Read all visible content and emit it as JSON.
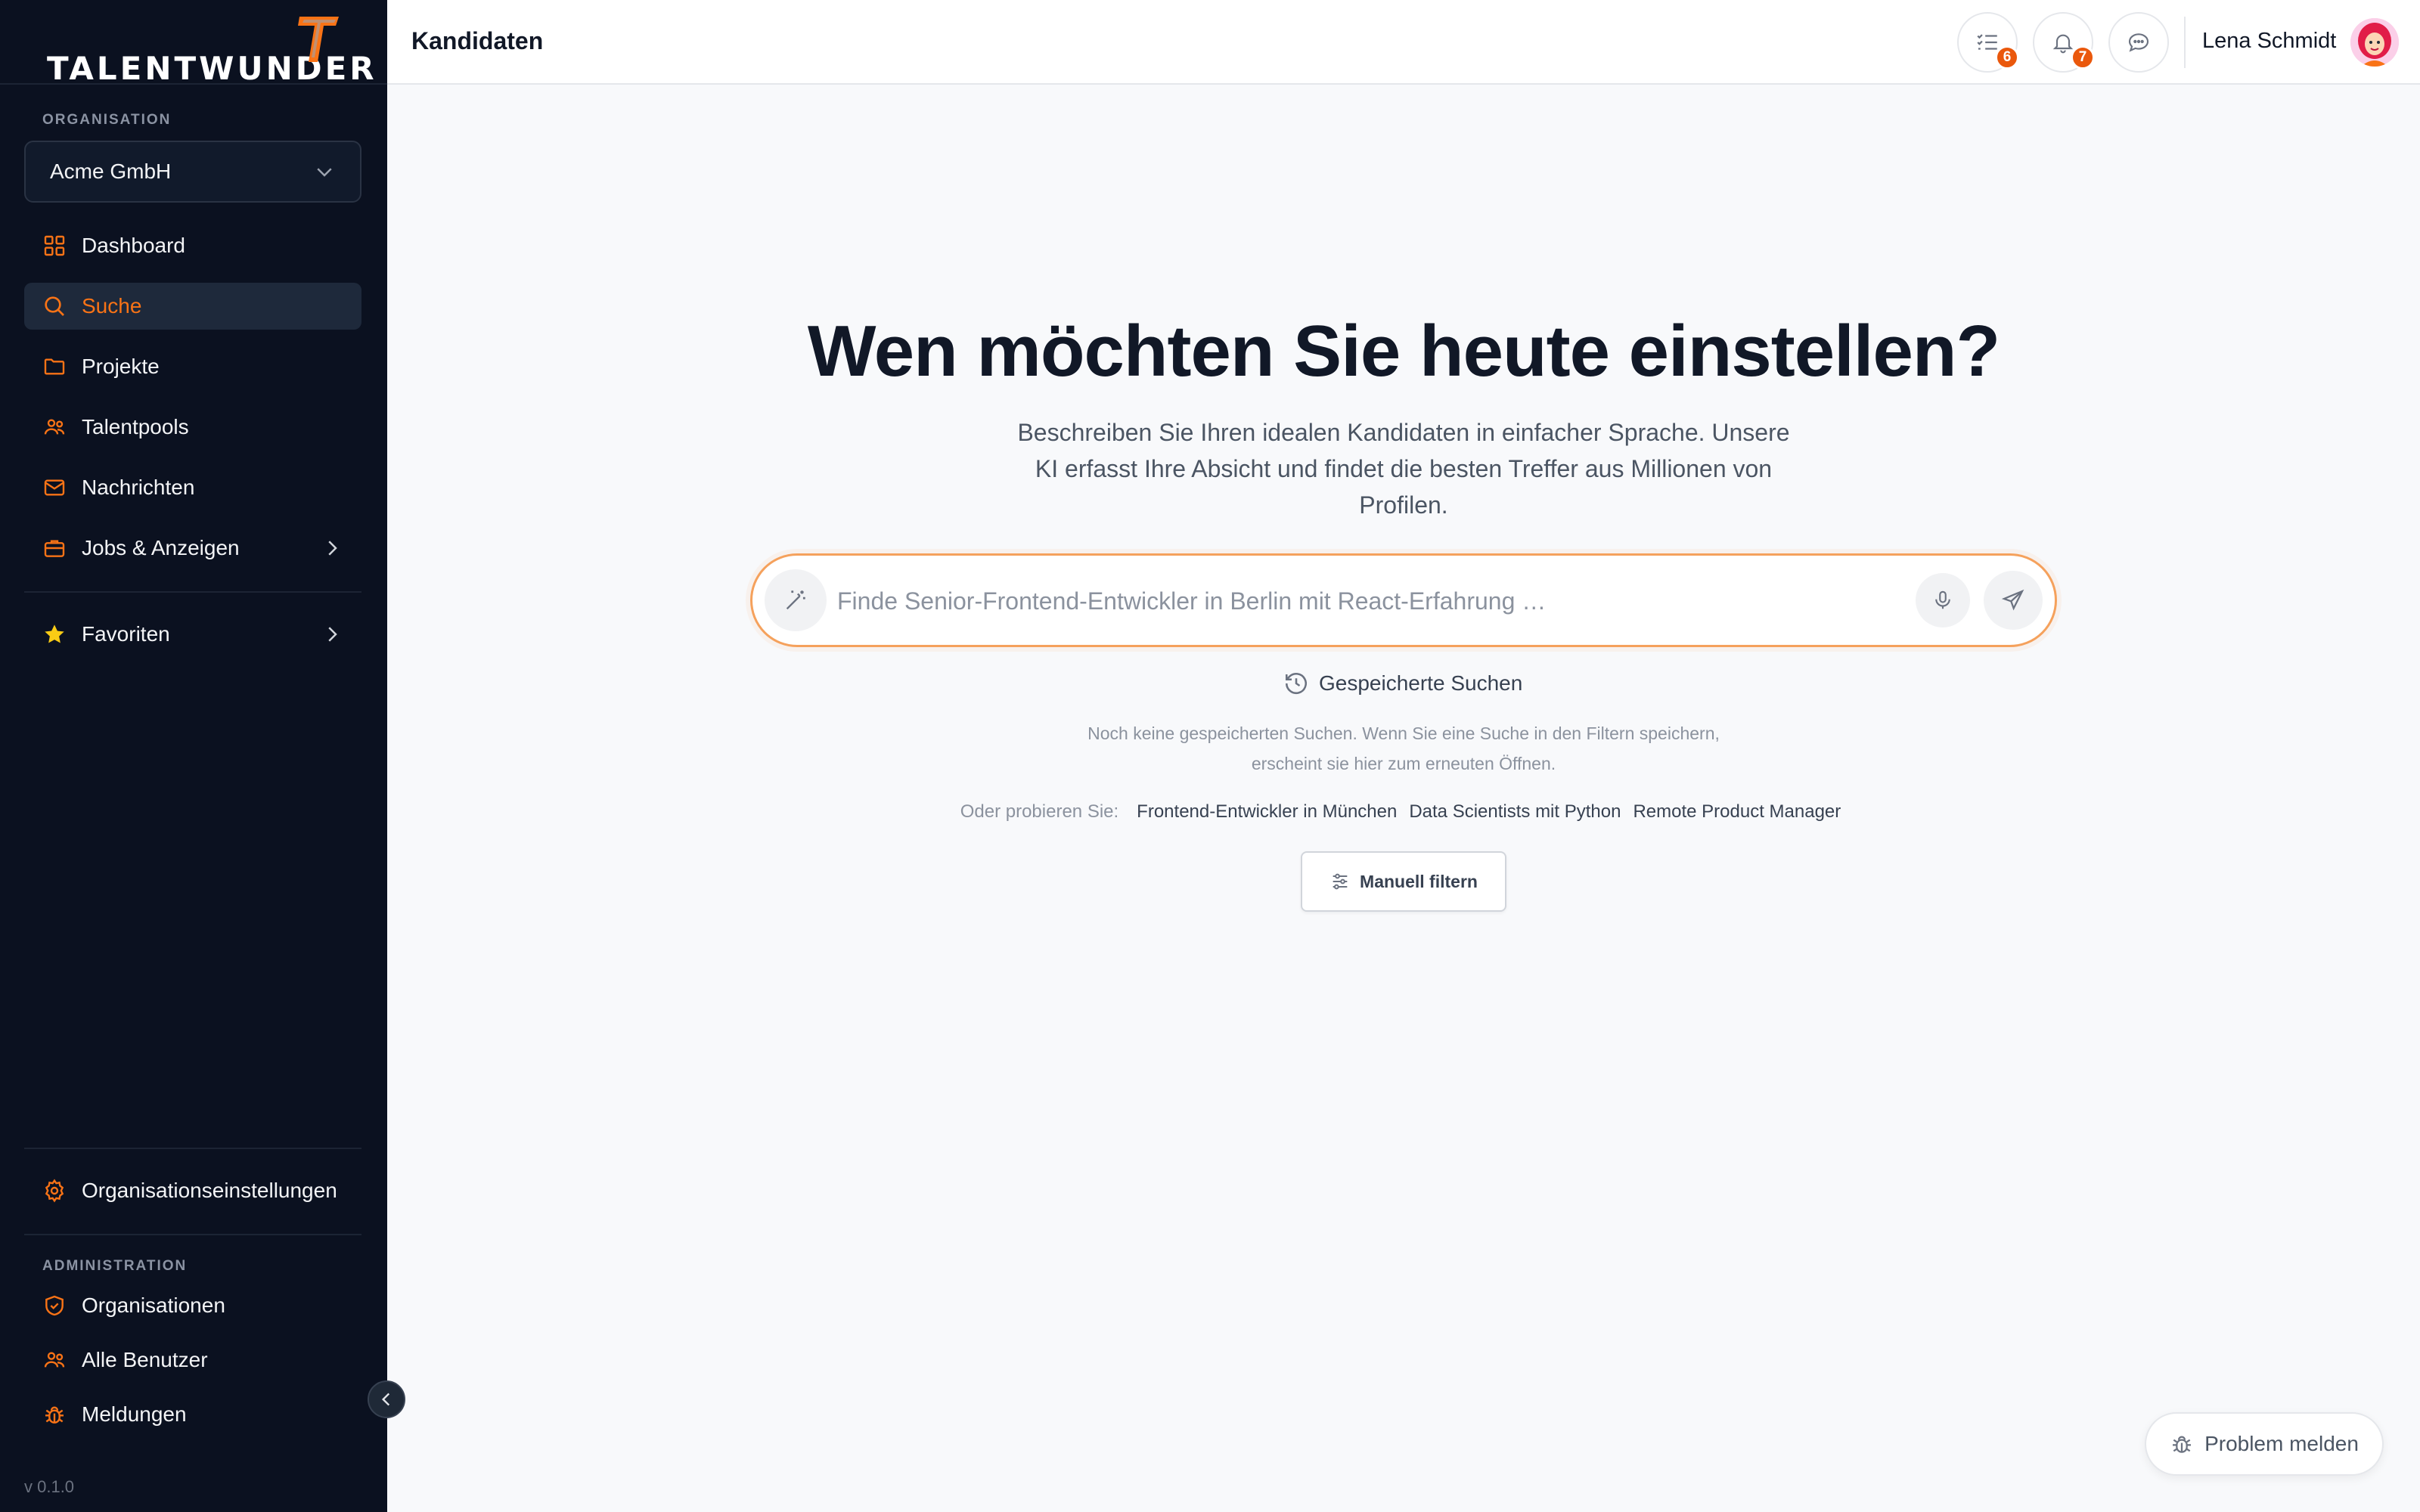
{
  "sidebar": {
    "logo_text": "TALENTWUNDER",
    "org_section_label": "ORGANISATION",
    "org_selected": "Acme GmbH",
    "nav": [
      {
        "label": "Dashboard",
        "icon": "grid-icon"
      },
      {
        "label": "Suche",
        "icon": "search-icon",
        "active": true
      },
      {
        "label": "Projekte",
        "icon": "folder-icon"
      },
      {
        "label": "Talentpools",
        "icon": "users-icon"
      },
      {
        "label": "Nachrichten",
        "icon": "mail-icon"
      },
      {
        "label": "Jobs & Anzeigen",
        "icon": "briefcase-icon"
      }
    ],
    "favorites_label": "Favoriten",
    "org_settings_label": "Organisationseinstellungen",
    "admin_section_label": "ADMINISTRATION",
    "admin_nav": [
      {
        "label": "Organisationen",
        "icon": "shield-icon"
      },
      {
        "label": "Alle Benutzer",
        "icon": "users-icon"
      },
      {
        "label": "Meldungen",
        "icon": "bug-icon"
      }
    ],
    "version": "v 0.1.0"
  },
  "header": {
    "title": "Kandidaten",
    "tasks_badge": "6",
    "notifications_badge": "7",
    "user_name": "Lena Schmidt"
  },
  "main": {
    "headline": "Wen möchten Sie heute einstellen?",
    "subline": "Beschreiben Sie Ihren idealen Kandidaten in einfacher Sprache. Unsere KI erfasst Ihre Absicht und findet die besten Treffer aus Millionen von Profilen.",
    "search_placeholder": "Finde Senior-Frontend-Entwickler in Berlin mit React-Erfahrung …",
    "saved_searches_label": "Gespeicherte Suchen",
    "saved_searches_empty": "Noch keine gespeicherten Suchen. Wenn Sie eine Suche in den Filtern speichern, erscheint sie hier zum erneuten Öffnen.",
    "try_label": "Oder probieren Sie:",
    "suggestions": [
      "Frontend-Entwickler in München",
      "Data Scientists mit Python",
      "Remote Product Manager"
    ],
    "manual_filter_label": "Manuell filtern",
    "report_problem_label": "Problem melden"
  },
  "colors": {
    "accent": "#f97316",
    "sidebar_bg": "#0b1120",
    "badge": "#ea580c"
  }
}
